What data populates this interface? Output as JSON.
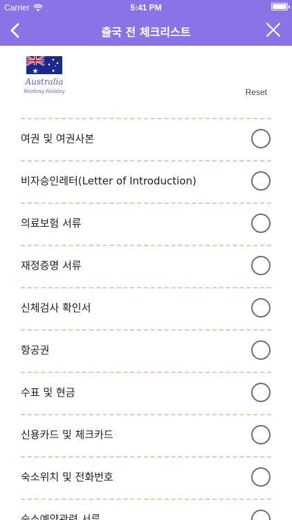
{
  "status_bar": {
    "carrier": "Carrier",
    "time": "5:41 PM"
  },
  "nav": {
    "title": "출국 전 체크리스트",
    "back_icon": "chevron-left-icon",
    "close_icon": "close-icon"
  },
  "logo": {
    "title": "Australia",
    "subtitle": "Working Holiday"
  },
  "reset_label": "Reset",
  "items": [
    {
      "label": "여권 및 여권사본",
      "checked": false
    },
    {
      "label": "비자승인레터(Letter of Introduction)",
      "checked": false
    },
    {
      "label": "의료보험 서류",
      "checked": false
    },
    {
      "label": "재정증명 서류",
      "checked": false
    },
    {
      "label": "신체검사 확인서",
      "checked": false
    },
    {
      "label": "항공권",
      "checked": false
    },
    {
      "label": "수표 및 현금",
      "checked": false
    },
    {
      "label": "신용카드 및 체크카드",
      "checked": false
    },
    {
      "label": "숙소위치 및 전화번호",
      "checked": false
    },
    {
      "label": "숙소예약관련 서류",
      "checked": false
    }
  ],
  "colors": {
    "accent": "#8a73e6",
    "divider": "#f2c6a7"
  }
}
